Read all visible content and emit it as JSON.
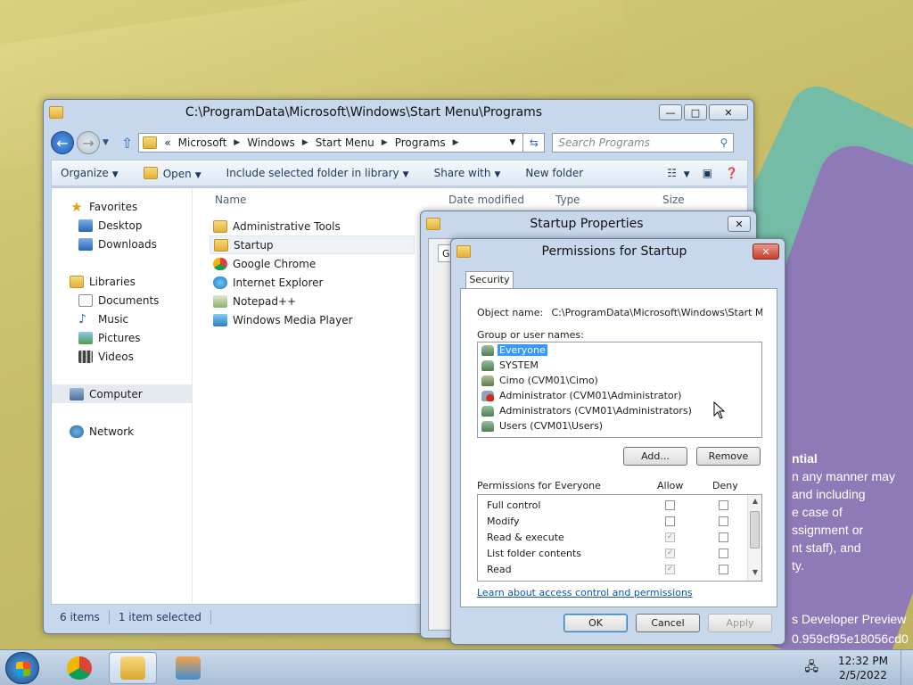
{
  "desktop": {
    "watermark_lines": [
      "ntial",
      "n any manner may",
      "and including",
      "e case of",
      "ssignment or",
      "nt staff), and",
      "ty."
    ],
    "build_lines": [
      "s Developer Preview",
      "0.959cf95e18056cd0"
    ]
  },
  "explorer": {
    "title": "C:\\ProgramData\\Microsoft\\Windows\\Start Menu\\Programs",
    "address": {
      "overflow": "«",
      "crumbs": [
        "Microsoft",
        "Windows",
        "Start Menu",
        "Programs"
      ]
    },
    "search_placeholder": "Search Programs",
    "toolbar": {
      "organize": "Organize",
      "open": "Open",
      "include": "Include selected folder in library",
      "share": "Share with",
      "new_folder": "New folder"
    },
    "nav": [
      {
        "label": "Favorites",
        "icon": "star-icon"
      },
      {
        "label": "Desktop",
        "icon": "desktop-icon"
      },
      {
        "label": "Downloads",
        "icon": "downloads-icon"
      },
      {
        "label": "Libraries",
        "icon": "libraries-icon"
      },
      {
        "label": "Documents",
        "icon": "documents-icon"
      },
      {
        "label": "Music",
        "icon": "music-icon"
      },
      {
        "label": "Pictures",
        "icon": "pictures-icon"
      },
      {
        "label": "Videos",
        "icon": "videos-icon"
      },
      {
        "label": "Computer",
        "icon": "computer-icon"
      },
      {
        "label": "Network",
        "icon": "network-icon"
      }
    ],
    "columns": [
      "Name",
      "Date modified",
      "Type",
      "Size"
    ],
    "files": [
      {
        "name": "Administrative Tools",
        "icon": "folder-icon"
      },
      {
        "name": "Startup",
        "icon": "folder-icon"
      },
      {
        "name": "Google Chrome",
        "icon": "chrome-icon"
      },
      {
        "name": "Internet Explorer",
        "icon": "ie-icon"
      },
      {
        "name": "Notepad++",
        "icon": "notepad-icon"
      },
      {
        "name": "Windows Media Player",
        "icon": "media-player-icon"
      }
    ],
    "status": {
      "count": "6 items",
      "selected": "1 item selected"
    }
  },
  "props": {
    "title": "Startup Properties",
    "tab_stub": "Ge"
  },
  "perms": {
    "title": "Permissions for Startup",
    "tab": "Security",
    "object_label": "Object name:",
    "object_value": "C:\\ProgramData\\Microsoft\\Windows\\Start Menu\\P",
    "groups_label": "Group or user names:",
    "users": [
      "Everyone",
      "SYSTEM",
      "Cimo (CVM01\\Cimo)",
      "Administrator (CVM01\\Administrator)",
      "Administrators (CVM01\\Administrators)",
      "Users (CVM01\\Users)"
    ],
    "add_label": "Add...",
    "remove_label": "Remove",
    "perm_label": "Permissions for Everyone",
    "allow_label": "Allow",
    "deny_label": "Deny",
    "permissions": [
      "Full control",
      "Modify",
      "Read & execute",
      "List folder contents",
      "Read"
    ],
    "link": "Learn about access control and permissions",
    "ok_label": "OK",
    "cancel_label": "Cancel",
    "apply_label": "Apply"
  },
  "taskbar": {
    "time": "12:32 PM",
    "date": "2/5/2022"
  }
}
